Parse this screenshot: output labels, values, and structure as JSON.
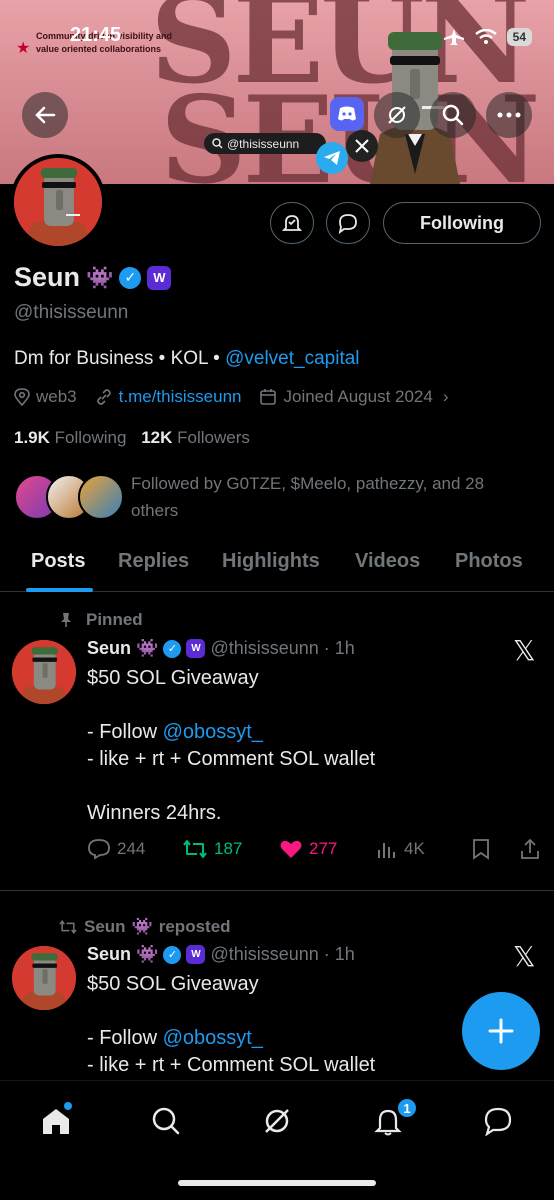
{
  "status_bar": {
    "time": "21:45",
    "battery": "54"
  },
  "banner": {
    "word": "SEUN",
    "note": "Community driven visibility and value oriented collaborations",
    "handle_chip": "@thisisseunn"
  },
  "profile": {
    "name": "Seun",
    "name_emoji": "👾",
    "handle": "@thisisseunn",
    "bio_prefix": "Dm for Business • KOL • ",
    "bio_link": "@velvet_capital",
    "location": "web3",
    "website": "t.me/thisisseunn",
    "joined": "Joined August 2024",
    "following_count": "1.9K",
    "following_label": "Following",
    "followers_count": "12K",
    "followers_label": "Followers",
    "followed_by": "Followed by G0TZE, $Meelo, pathezzy, and 28 others",
    "following_button": "Following"
  },
  "tabs": [
    "Posts",
    "Replies",
    "Highlights",
    "Videos",
    "Photos"
  ],
  "posts": [
    {
      "context": "Pinned",
      "name": "Seun",
      "emoji": "👾",
      "handle": "@thisisseunn",
      "time": "· 1h",
      "line1": "$50 SOL Giveaway",
      "line2_prefix": "- Follow ",
      "line2_link": "@obossyt_",
      "line3": "- like + rt + Comment SOL wallet",
      "line4": "Winners 24hrs.",
      "replies": "244",
      "reposts": "187",
      "likes": "277",
      "views": "4K"
    },
    {
      "context_name": "Seun",
      "context_emoji": "👾",
      "context_suffix": "reposted",
      "name": "Seun",
      "emoji": "👾",
      "handle": "@thisisseunn",
      "time": "· 1h",
      "line1": "$50 SOL Giveaway",
      "line2_prefix": "- Follow ",
      "line2_link": "@obossyt_",
      "line3": "- like + rt + Comment SOL wallet"
    }
  ],
  "nav": {
    "notification_badge": "1"
  },
  "colors": {
    "accent": "#1d9bf0",
    "like": "#f91880",
    "repost": "#00ba7c",
    "muted": "#71767b"
  }
}
